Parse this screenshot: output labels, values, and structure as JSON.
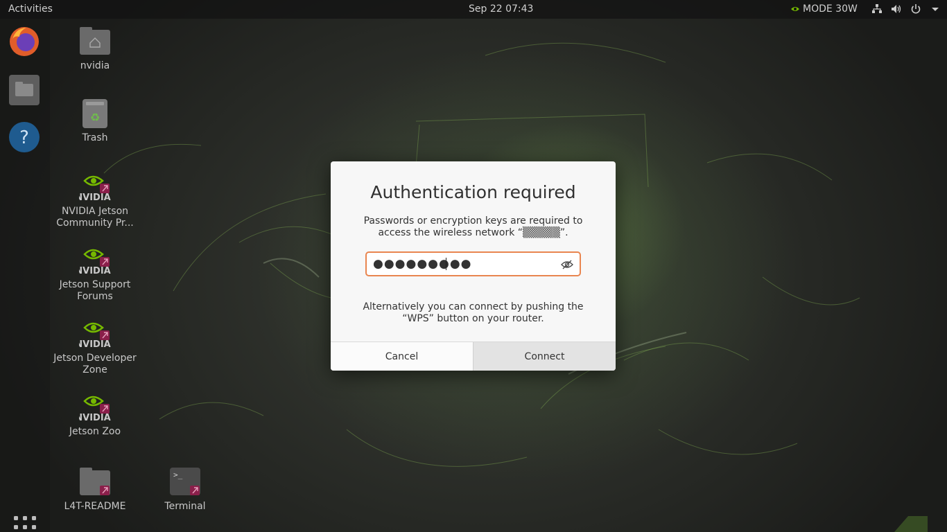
{
  "topbar": {
    "activities": "Activities",
    "clock": "Sep 22  07:43",
    "power_mode": "MODE 30W"
  },
  "dock": {
    "items": [
      {
        "name": "firefox-icon"
      },
      {
        "name": "files-icon"
      },
      {
        "name": "help-icon"
      }
    ]
  },
  "desktop": {
    "icons": [
      {
        "label": "nvidia"
      },
      {
        "label": "Trash"
      },
      {
        "label": "NVIDIA Jetson Community Pr..."
      },
      {
        "label": "Jetson Support Forums"
      },
      {
        "label": "Jetson Developer Zone"
      },
      {
        "label": "Jetson Zoo"
      },
      {
        "label": "L4T-README"
      },
      {
        "label": "Terminal"
      }
    ],
    "nvidia_logo_text": "NVIDIA"
  },
  "dialog": {
    "title": "Authentication required",
    "message_line1": "Passwords or encryption keys are required to",
    "message_line2": "access the wireless network “▒▒▒▒▒”.",
    "password_value": "●●●●●●●●●",
    "alt_line1": "Alternatively you can connect by pushing the",
    "alt_line2": "“WPS” button on your router.",
    "cancel_label": "Cancel",
    "connect_label": "Connect"
  },
  "colors": {
    "accent": "#e9854f",
    "dialog_bg": "#f7f7f7",
    "topbar_bg": "#121212",
    "nvidia_green": "#76b900"
  }
}
